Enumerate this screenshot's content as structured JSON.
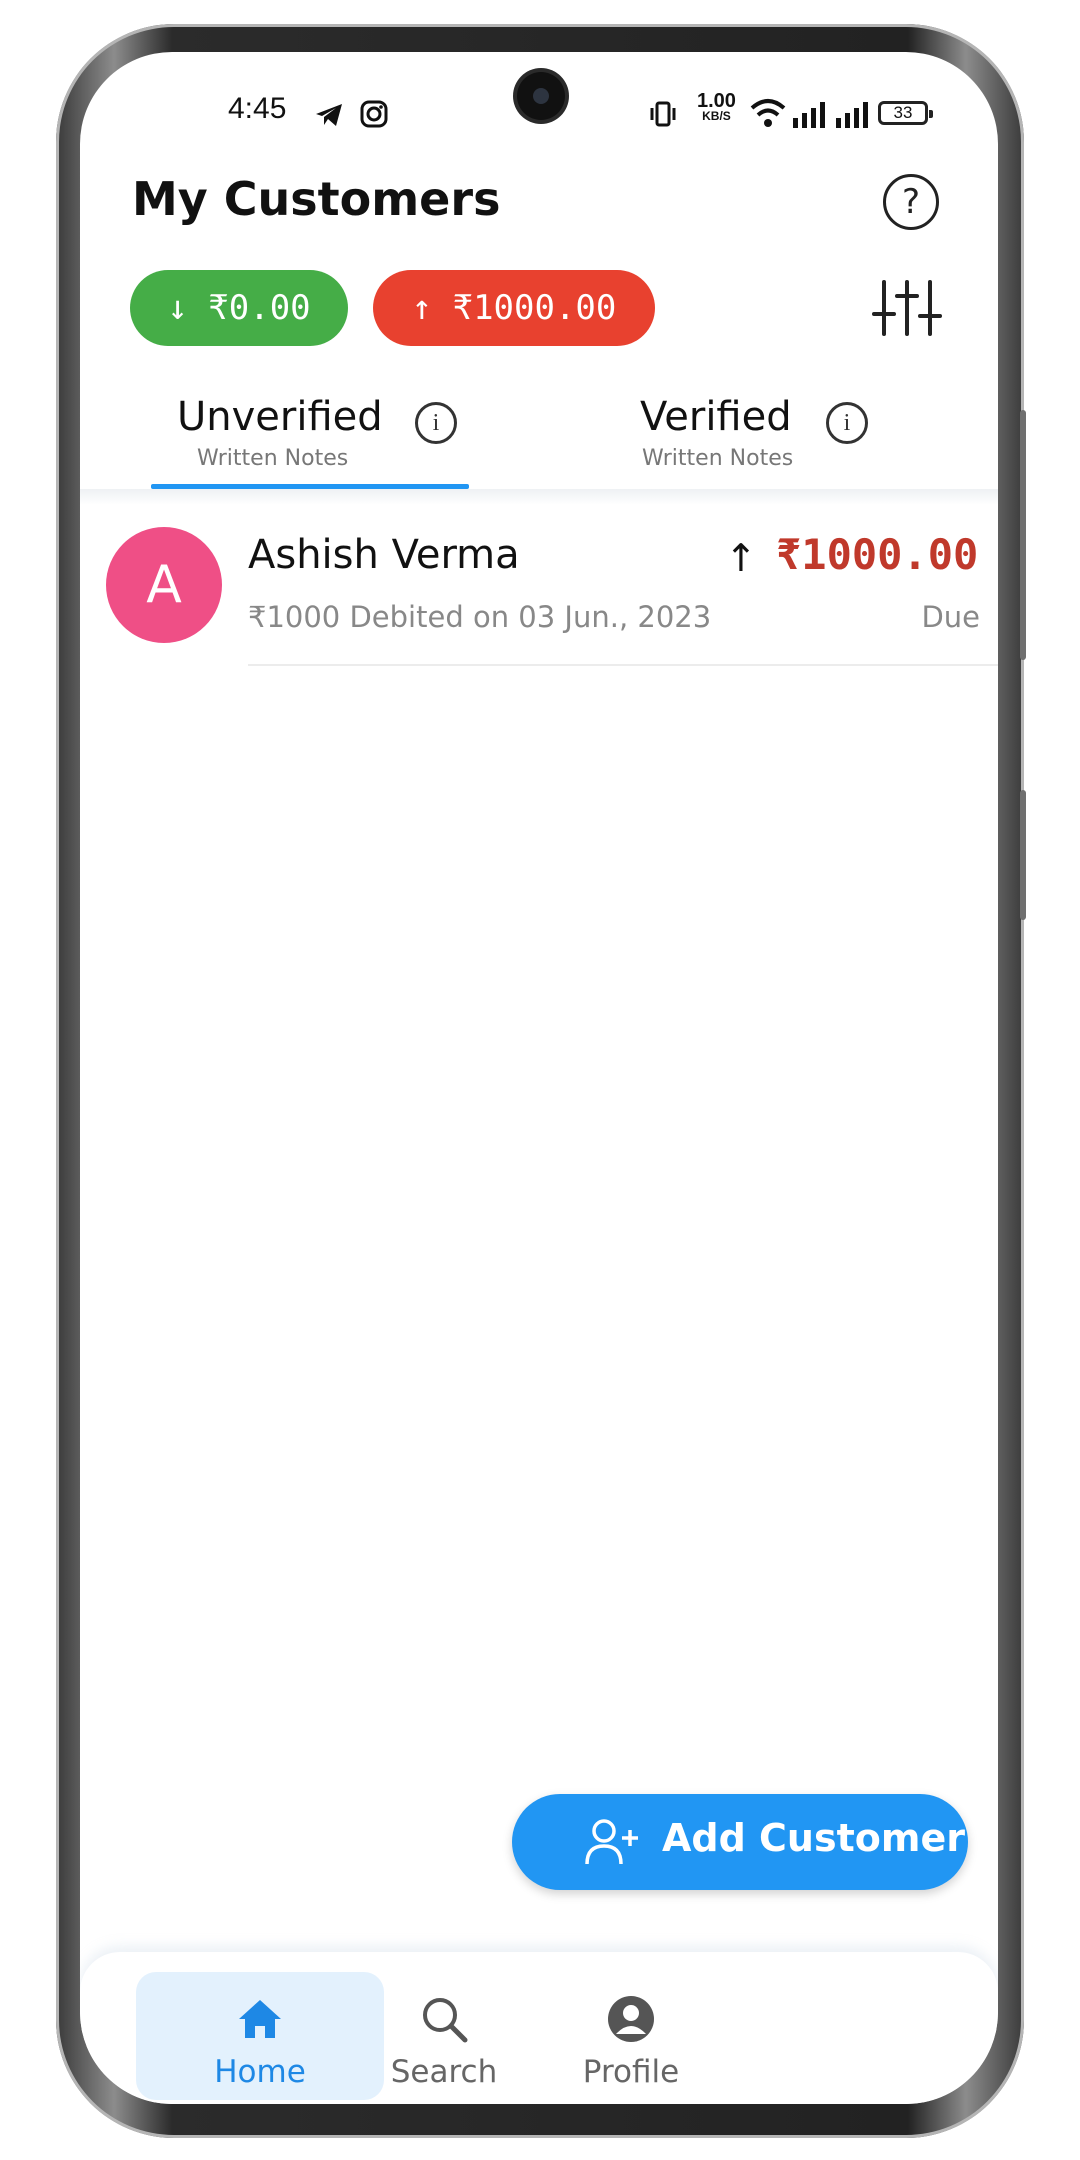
{
  "status_bar": {
    "time": "4:45",
    "net_speed_value": "1.00",
    "net_speed_unit": "KB/S",
    "battery": "33",
    "icons": [
      "telegram-icon",
      "instagram-icon",
      "vibrate-icon",
      "wifi-icon",
      "signal-icon",
      "signal-icon",
      "battery-icon"
    ]
  },
  "header": {
    "title": "My Customers",
    "help_icon": "?"
  },
  "summary": {
    "received_arrow": "↓",
    "received_amount": "₹0.00",
    "given_arrow": "↑",
    "given_amount": "₹1000.00",
    "received_color": "#45ad47",
    "given_color": "#e8412f"
  },
  "tabs": [
    {
      "label": "Unverified",
      "sub": "Written Notes",
      "active": true
    },
    {
      "label": "Verified",
      "sub": "Written Notes",
      "active": false
    }
  ],
  "info_glyph": "i",
  "customers": [
    {
      "initial": "A",
      "name": "Ashish Verma",
      "detail": "₹1000 Debited on 03 Jun., 2023",
      "arrow": "↑",
      "amount": "₹1000.00",
      "status": "Due",
      "avatar_color": "#ef4f86"
    }
  ],
  "fab": {
    "label": "Add Customer"
  },
  "bottom_nav": [
    {
      "label": "Home",
      "icon": "home-icon",
      "active": true
    },
    {
      "label": "Search",
      "icon": "search-icon",
      "active": false
    },
    {
      "label": "Profile",
      "icon": "profile-icon",
      "active": false
    }
  ],
  "colors": {
    "accent": "#2196f3",
    "due": "#c0392b"
  }
}
